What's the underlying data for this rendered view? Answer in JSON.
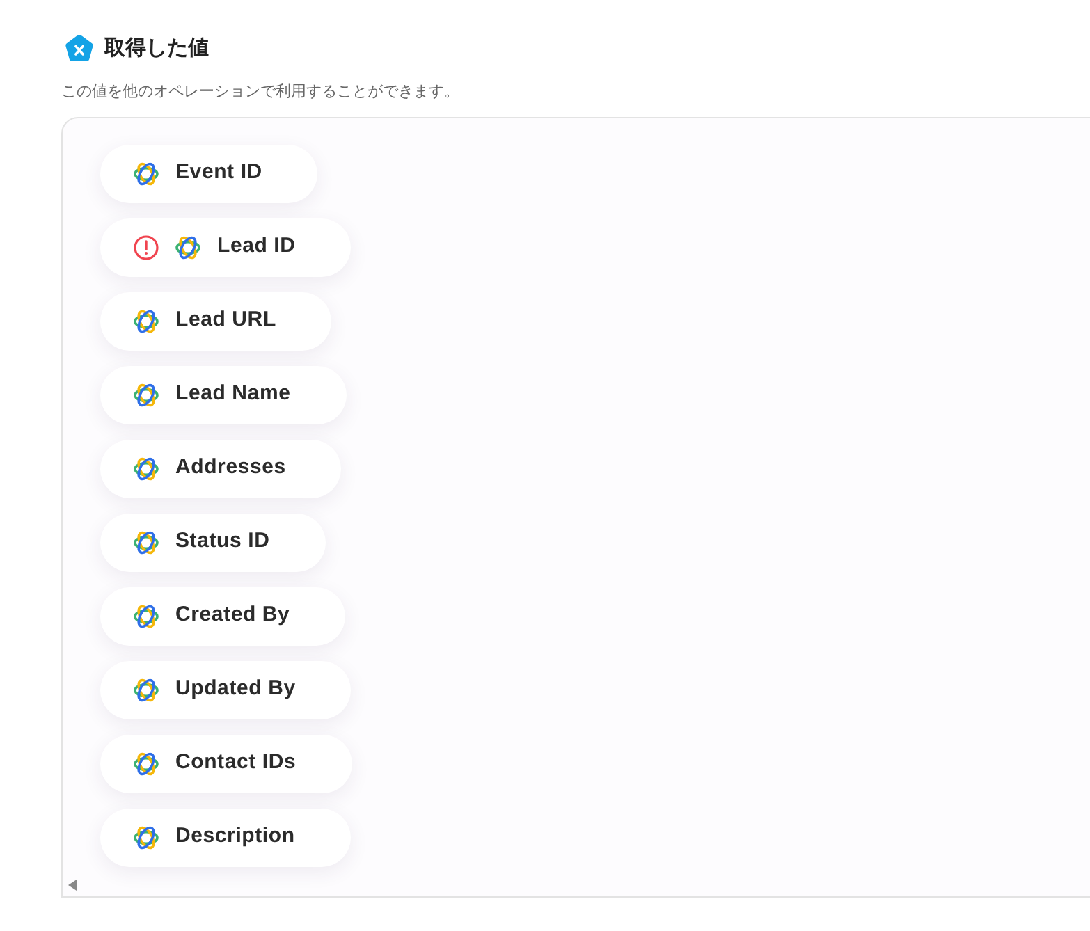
{
  "header": {
    "title": "取得した値",
    "subtitle": "この値を他のオペレーションで利用することができます。"
  },
  "values": [
    {
      "label": "Event ID",
      "warning": false
    },
    {
      "label": "Lead ID",
      "warning": true
    },
    {
      "label": "Lead URL",
      "warning": false
    },
    {
      "label": "Lead Name",
      "warning": false
    },
    {
      "label": "Addresses",
      "warning": false
    },
    {
      "label": "Status ID",
      "warning": false
    },
    {
      "label": "Created By",
      "warning": false
    },
    {
      "label": "Updated By",
      "warning": false
    },
    {
      "label": "Contact IDs",
      "warning": false
    },
    {
      "label": "Description",
      "warning": false
    }
  ]
}
